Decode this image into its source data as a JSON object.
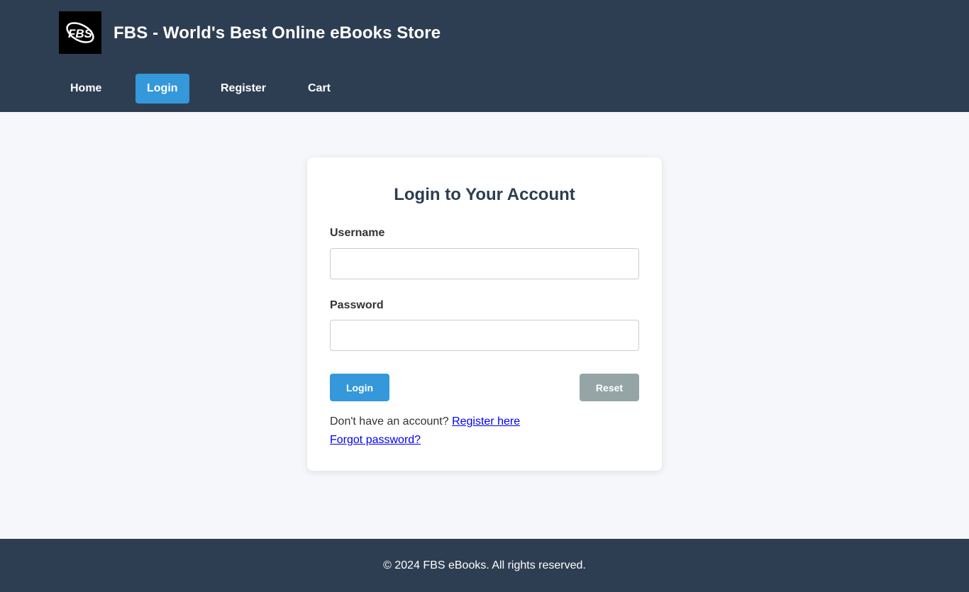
{
  "header": {
    "logo_text": "FBS",
    "site_title": "FBS - World's Best Online eBooks Store"
  },
  "nav": {
    "items": [
      {
        "label": "Home",
        "active": false
      },
      {
        "label": "Login",
        "active": true
      },
      {
        "label": "Register",
        "active": false
      },
      {
        "label": "Cart",
        "active": false
      }
    ]
  },
  "login_form": {
    "title": "Login to Your Account",
    "username_label": "Username",
    "username_value": "",
    "password_label": "Password",
    "password_value": "",
    "login_button": "Login",
    "reset_button": "Reset",
    "register_prompt": "Don't have an account?",
    "register_link": "Register here",
    "forgot_link": "Forgot password?"
  },
  "footer": {
    "copyright": "© 2024 FBS eBooks. All rights reserved."
  },
  "colors": {
    "header_bg": "#2e3e52",
    "accent": "#3498db",
    "reset_button": "#95a5a6",
    "page_bg": "#f5f7fa"
  }
}
